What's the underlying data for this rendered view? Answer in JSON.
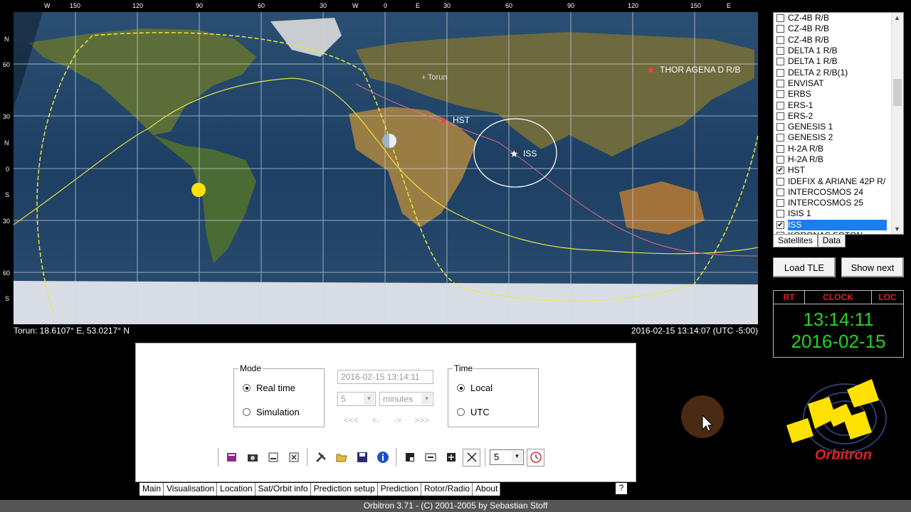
{
  "map": {
    "lon_labels": [
      "W",
      "150",
      "120",
      "90",
      "60",
      "30",
      "W",
      "0",
      "E",
      "30",
      "60",
      "90",
      "120",
      "150",
      "E"
    ],
    "lat_labels_north": [
      "N",
      "60",
      "30",
      "N",
      "0"
    ],
    "lat_labels_south": [
      "S",
      "30",
      "60",
      "S"
    ],
    "satellites": [
      {
        "name": "HST"
      },
      {
        "name": "ISS"
      },
      {
        "name": "THOR AGENA D R/B"
      }
    ],
    "city": "Torun"
  },
  "status": {
    "location": "Torun: 18.6107° E, 53.0217° N",
    "datetime": "2016-02-15 13:14:07 (UTC -5:00)"
  },
  "sat_list": [
    {
      "name": "CZ-4B R/B",
      "checked": false
    },
    {
      "name": "CZ-4B R/B",
      "checked": false
    },
    {
      "name": "CZ-4B R/B",
      "checked": false
    },
    {
      "name": "DELTA 1 R/B",
      "checked": false
    },
    {
      "name": "DELTA 1 R/B",
      "checked": false
    },
    {
      "name": "DELTA 2 R/B(1)",
      "checked": false
    },
    {
      "name": "ENVISAT",
      "checked": false
    },
    {
      "name": "ERBS",
      "checked": false
    },
    {
      "name": "ERS-1",
      "checked": false
    },
    {
      "name": "ERS-2",
      "checked": false
    },
    {
      "name": "GENESIS 1",
      "checked": false
    },
    {
      "name": "GENESIS 2",
      "checked": false
    },
    {
      "name": "H-2A R/B",
      "checked": false
    },
    {
      "name": "H-2A R/B",
      "checked": false
    },
    {
      "name": "HST",
      "checked": true
    },
    {
      "name": "IDEFIX & ARIANE 42P R/",
      "checked": false
    },
    {
      "name": "INTERCOSMOS 24",
      "checked": false
    },
    {
      "name": "INTERCOSMOS 25",
      "checked": false
    },
    {
      "name": "ISIS 1",
      "checked": false
    },
    {
      "name": "ISS",
      "checked": true,
      "selected": true
    },
    {
      "name": "KORONAS FOTON",
      "checked": false
    }
  ],
  "list_tabs": [
    "Satellites",
    "Data"
  ],
  "buttons": {
    "load_tle": "Load TLE",
    "show_next": "Show next"
  },
  "clock": {
    "headers": [
      "RT",
      "CLOCK",
      "LOC"
    ],
    "time": "13:14:11",
    "date": "2016-02-15"
  },
  "panel": {
    "mode_title": "Mode",
    "mode_real": "Real time",
    "mode_sim": "Simulation",
    "sim_datetime": "2016-02-15 13:14:11",
    "step_value": "5",
    "step_unit": "minutes",
    "nav": [
      "<<<",
      "<-",
      "->",
      ">>>"
    ],
    "time_title": "Time",
    "time_local": "Local",
    "time_utc": "UTC",
    "zoom_value": "5"
  },
  "tabs": [
    "Main",
    "Visualisation",
    "Location",
    "Sat/Orbit info",
    "Prediction setup",
    "Prediction",
    "Rotor/Radio",
    "About"
  ],
  "help": "?",
  "footer": "Orbitron 3.71 - (C) 2001-2005 by Sebastian Stoff",
  "logo_text": "Orbitron",
  "colors": {
    "clock_green": "#21d421",
    "clock_red": "#e02020",
    "selection": "#1b7dee"
  }
}
